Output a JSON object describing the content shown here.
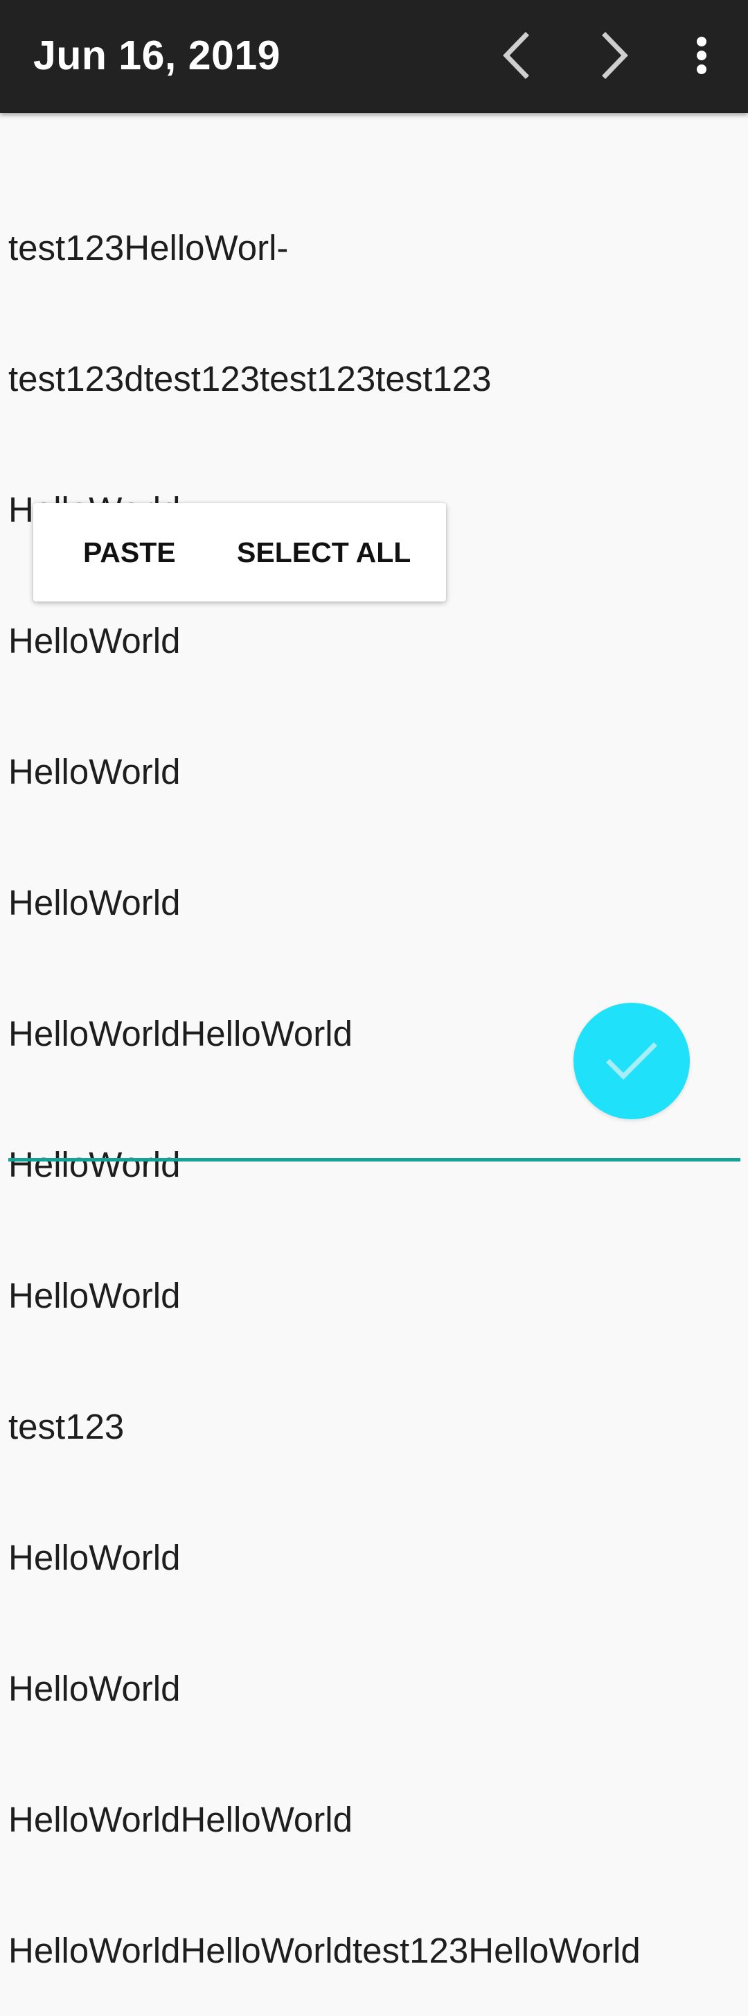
{
  "app_bar": {
    "title": "Jun 16, 2019",
    "prev_icon": "chevron-left-icon",
    "next_icon": "chevron-right-icon",
    "more_icon": "more-vert-icon",
    "background_color": "#222222"
  },
  "editor": {
    "lines": [
      "test123HelloWorl-",
      "test123dtest123test123test123",
      "HelloWorld",
      "HelloWorld",
      "HelloWorld",
      "HelloWorld",
      "HelloWorldHelloWorld",
      "HelloWorld",
      "HelloWorld",
      "test123",
      "HelloWorld",
      "HelloWorld",
      "HelloWorldHelloWorld",
      "HelloWorldHelloWorldtest123HelloWorld"
    ],
    "underline_color": "#14a394"
  },
  "context_menu": {
    "paste_label": "PASTE",
    "select_all_label": "SELECT ALL"
  },
  "fab": {
    "icon": "check-icon",
    "color": "#1fe1f9"
  }
}
